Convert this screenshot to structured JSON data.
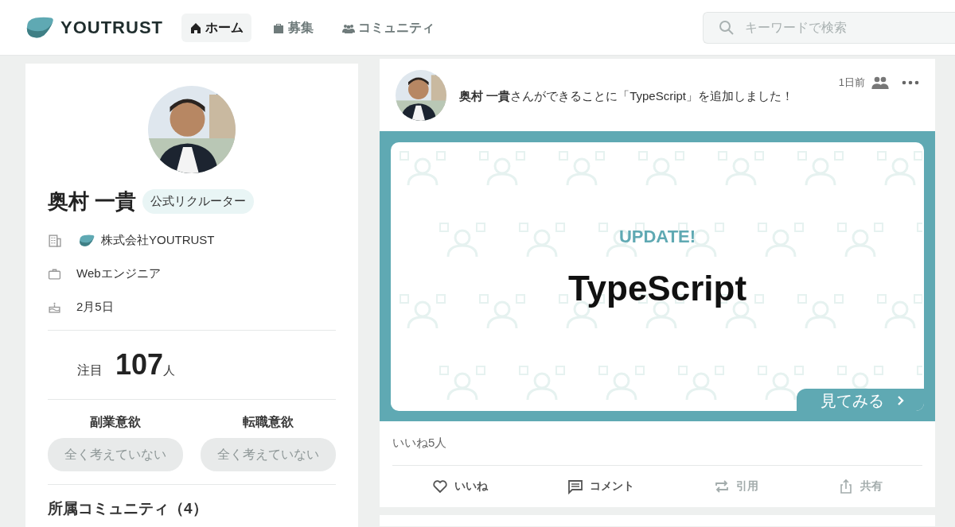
{
  "header": {
    "logo": "YOUTRUST",
    "nav": [
      {
        "label": "ホーム",
        "kind": "home",
        "selected": true
      },
      {
        "label": "募集",
        "kind": "bag",
        "selected": false
      },
      {
        "label": "コミュニティ",
        "kind": "people",
        "selected": false
      }
    ],
    "search": {
      "placeholder": "キーワードで検索"
    }
  },
  "profile": {
    "name": "奥村 一貴",
    "badge": "公式リクルーター",
    "details": [
      {
        "kind": "company",
        "text": "株式会社YOUTRUST"
      },
      {
        "kind": "job",
        "text": "Webエンジニア"
      },
      {
        "kind": "birthday",
        "text": "2月5日"
      }
    ],
    "attention": {
      "label": "注目",
      "count": "107",
      "unit": "人"
    },
    "motivations": [
      {
        "label": "副業意欲",
        "value": "全く考えていない"
      },
      {
        "label": "転職意欲",
        "value": "全く考えていない"
      }
    ],
    "communities_heading": "所属コミュニティ（4）"
  },
  "post": {
    "message": "**奥村 一貴**さんができることに「TypeScript」を追加しました！",
    "time": "1日前",
    "banner": {
      "heading": "UPDATE!",
      "title": "TypeScript",
      "button": "見てみる"
    },
    "likes": "いいね5人",
    "actions": [
      {
        "kind": "like",
        "label": "いいね",
        "disabled": false
      },
      {
        "kind": "comment",
        "label": "コメント",
        "disabled": false
      },
      {
        "kind": "quote",
        "label": "引用",
        "disabled": true
      },
      {
        "kind": "share",
        "label": "共有",
        "disabled": true
      }
    ]
  }
}
